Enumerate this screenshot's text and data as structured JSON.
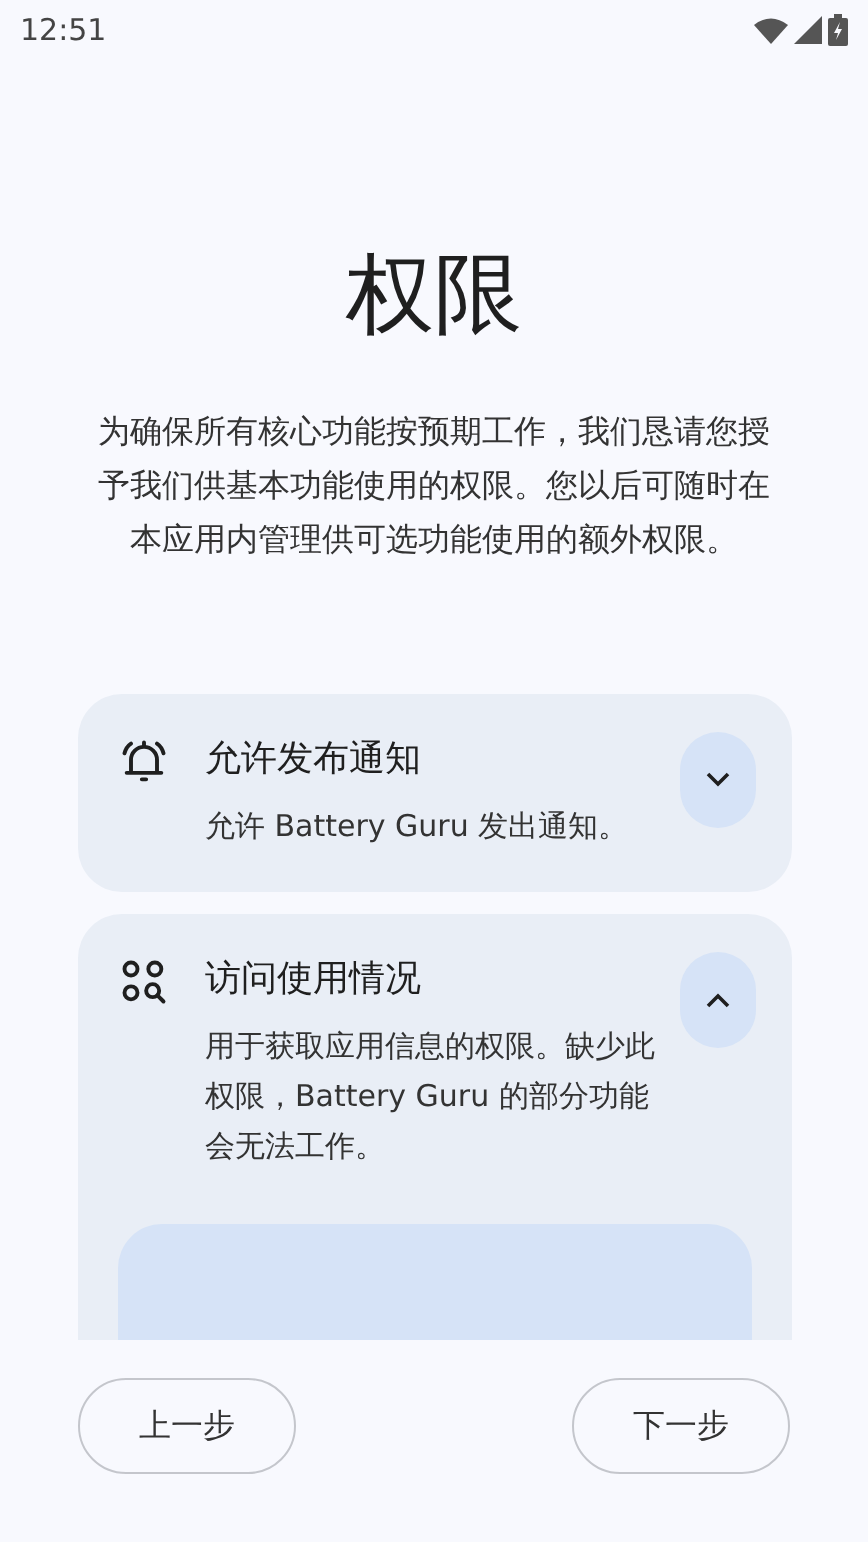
{
  "status_bar": {
    "time": "12:51"
  },
  "title": "权限",
  "intro": "为确保所有核心功能按预期工作，我们恳请您授予我们供基本功能使用的权限。您以后可随时在本应用内管理供可选功能使用的额外权限。",
  "permissions": [
    {
      "kind": "notification",
      "title": "允许发布通知",
      "description": "允许 Battery Guru 发出通知。",
      "expanded": false
    },
    {
      "kind": "usage",
      "title": "访问使用情况",
      "description": "用于获取应用信息的权限。缺少此权限，Battery Guru 的部分功能会无法工作。",
      "expanded": true
    }
  ],
  "buttons": {
    "back": "上一步",
    "next": "下一步"
  }
}
